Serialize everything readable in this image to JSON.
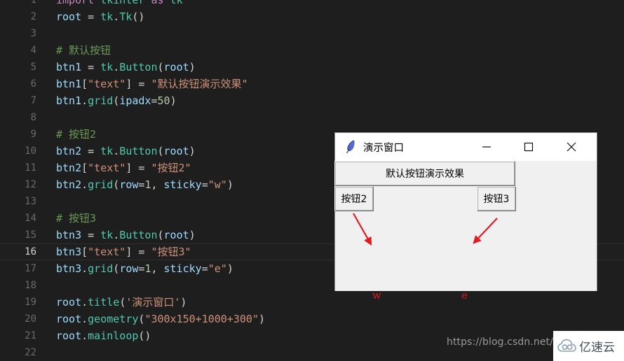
{
  "editor": {
    "theme": {
      "background": "#1e1e1e",
      "current_line_background": "#1f1f20",
      "line_number_color": "#6a6a6a",
      "keyword_color": "#c586c0",
      "string_color": "#ce9178",
      "comment_color": "#6a9955",
      "identifier_color": "#9cdcfe",
      "function_color": "#4ec9b0",
      "number_color": "#b5cea8"
    },
    "current_line": 16,
    "lines": [
      {
        "num": "1",
        "tokens": [
          {
            "t": "kw",
            "s": "import"
          },
          {
            "t": "plain",
            "s": " "
          },
          {
            "t": "mod",
            "s": "tkinter"
          },
          {
            "t": "plain",
            "s": " "
          },
          {
            "t": "kw",
            "s": "as"
          },
          {
            "t": "plain",
            "s": " "
          },
          {
            "t": "mod",
            "s": "tk"
          }
        ]
      },
      {
        "num": "2",
        "tokens": [
          {
            "t": "id",
            "s": "root"
          },
          {
            "t": "plain",
            "s": " "
          },
          {
            "t": "op",
            "s": "="
          },
          {
            "t": "plain",
            "s": " "
          },
          {
            "t": "mod",
            "s": "tk"
          },
          {
            "t": "punc",
            "s": "."
          },
          {
            "t": "fn",
            "s": "Tk"
          },
          {
            "t": "punc",
            "s": "()"
          }
        ]
      },
      {
        "num": "3",
        "tokens": []
      },
      {
        "num": "4",
        "tokens": [
          {
            "t": "com",
            "s": "# 默认按钮"
          }
        ]
      },
      {
        "num": "5",
        "tokens": [
          {
            "t": "id",
            "s": "btn1"
          },
          {
            "t": "plain",
            "s": " "
          },
          {
            "t": "op",
            "s": "="
          },
          {
            "t": "plain",
            "s": " "
          },
          {
            "t": "mod",
            "s": "tk"
          },
          {
            "t": "punc",
            "s": "."
          },
          {
            "t": "fn",
            "s": "Button"
          },
          {
            "t": "punc",
            "s": "("
          },
          {
            "t": "id",
            "s": "root"
          },
          {
            "t": "punc",
            "s": ")"
          }
        ]
      },
      {
        "num": "6",
        "tokens": [
          {
            "t": "id",
            "s": "btn1"
          },
          {
            "t": "punc",
            "s": "["
          },
          {
            "t": "str",
            "s": "\"text\""
          },
          {
            "t": "punc",
            "s": "]"
          },
          {
            "t": "plain",
            "s": " "
          },
          {
            "t": "op",
            "s": "="
          },
          {
            "t": "plain",
            "s": " "
          },
          {
            "t": "str",
            "s": "\"默认按钮演示效果\""
          }
        ]
      },
      {
        "num": "7",
        "tokens": [
          {
            "t": "id",
            "s": "btn1"
          },
          {
            "t": "punc",
            "s": "."
          },
          {
            "t": "fn",
            "s": "grid"
          },
          {
            "t": "punc",
            "s": "("
          },
          {
            "t": "id",
            "s": "ipadx"
          },
          {
            "t": "op",
            "s": "="
          },
          {
            "t": "num",
            "s": "50"
          },
          {
            "t": "punc",
            "s": ")"
          }
        ]
      },
      {
        "num": "8",
        "tokens": []
      },
      {
        "num": "9",
        "tokens": [
          {
            "t": "com",
            "s": "# 按钮2"
          }
        ]
      },
      {
        "num": "10",
        "tokens": [
          {
            "t": "id",
            "s": "btn2"
          },
          {
            "t": "plain",
            "s": " "
          },
          {
            "t": "op",
            "s": "="
          },
          {
            "t": "plain",
            "s": " "
          },
          {
            "t": "mod",
            "s": "tk"
          },
          {
            "t": "punc",
            "s": "."
          },
          {
            "t": "fn",
            "s": "Button"
          },
          {
            "t": "punc",
            "s": "("
          },
          {
            "t": "id",
            "s": "root"
          },
          {
            "t": "punc",
            "s": ")"
          }
        ]
      },
      {
        "num": "11",
        "tokens": [
          {
            "t": "id",
            "s": "btn2"
          },
          {
            "t": "punc",
            "s": "["
          },
          {
            "t": "str",
            "s": "\"text\""
          },
          {
            "t": "punc",
            "s": "]"
          },
          {
            "t": "plain",
            "s": " "
          },
          {
            "t": "op",
            "s": "="
          },
          {
            "t": "plain",
            "s": " "
          },
          {
            "t": "str",
            "s": "\"按钮2\""
          }
        ]
      },
      {
        "num": "12",
        "tokens": [
          {
            "t": "id",
            "s": "btn2"
          },
          {
            "t": "punc",
            "s": "."
          },
          {
            "t": "fn",
            "s": "grid"
          },
          {
            "t": "punc",
            "s": "("
          },
          {
            "t": "id",
            "s": "row"
          },
          {
            "t": "op",
            "s": "="
          },
          {
            "t": "num",
            "s": "1"
          },
          {
            "t": "punc",
            "s": ", "
          },
          {
            "t": "id",
            "s": "sticky"
          },
          {
            "t": "op",
            "s": "="
          },
          {
            "t": "str",
            "s": "\"w\""
          },
          {
            "t": "punc",
            "s": ")"
          }
        ]
      },
      {
        "num": "13",
        "tokens": []
      },
      {
        "num": "14",
        "tokens": [
          {
            "t": "com",
            "s": "# 按钮3"
          }
        ]
      },
      {
        "num": "15",
        "tokens": [
          {
            "t": "id",
            "s": "btn3"
          },
          {
            "t": "plain",
            "s": " "
          },
          {
            "t": "op",
            "s": "="
          },
          {
            "t": "plain",
            "s": " "
          },
          {
            "t": "mod",
            "s": "tk"
          },
          {
            "t": "punc",
            "s": "."
          },
          {
            "t": "fn",
            "s": "Button"
          },
          {
            "t": "punc",
            "s": "("
          },
          {
            "t": "id",
            "s": "root"
          },
          {
            "t": "punc",
            "s": ")"
          }
        ]
      },
      {
        "num": "16",
        "tokens": [
          {
            "t": "id",
            "s": "btn3"
          },
          {
            "t": "punc",
            "s": "["
          },
          {
            "t": "str",
            "s": "\"text\""
          },
          {
            "t": "punc",
            "s": "]"
          },
          {
            "t": "plain",
            "s": " "
          },
          {
            "t": "op",
            "s": "="
          },
          {
            "t": "plain",
            "s": " "
          },
          {
            "t": "str",
            "s": "\"按钮3\""
          }
        ]
      },
      {
        "num": "17",
        "tokens": [
          {
            "t": "id",
            "s": "btn3"
          },
          {
            "t": "punc",
            "s": "."
          },
          {
            "t": "fn",
            "s": "grid"
          },
          {
            "t": "punc",
            "s": "("
          },
          {
            "t": "id",
            "s": "row"
          },
          {
            "t": "op",
            "s": "="
          },
          {
            "t": "num",
            "s": "1"
          },
          {
            "t": "punc",
            "s": ", "
          },
          {
            "t": "id",
            "s": "sticky"
          },
          {
            "t": "op",
            "s": "="
          },
          {
            "t": "str",
            "s": "\"e\""
          },
          {
            "t": "punc",
            "s": ")"
          }
        ]
      },
      {
        "num": "18",
        "tokens": []
      },
      {
        "num": "19",
        "tokens": [
          {
            "t": "id",
            "s": "root"
          },
          {
            "t": "punc",
            "s": "."
          },
          {
            "t": "fn",
            "s": "title"
          },
          {
            "t": "punc",
            "s": "("
          },
          {
            "t": "str",
            "s": "'演示窗口'"
          },
          {
            "t": "punc",
            "s": ")"
          }
        ]
      },
      {
        "num": "20",
        "tokens": [
          {
            "t": "id",
            "s": "root"
          },
          {
            "t": "punc",
            "s": "."
          },
          {
            "t": "fn",
            "s": "geometry"
          },
          {
            "t": "punc",
            "s": "("
          },
          {
            "t": "str",
            "s": "\"300x150+1000+300\""
          },
          {
            "t": "punc",
            "s": ")"
          }
        ]
      },
      {
        "num": "21",
        "tokens": [
          {
            "t": "id",
            "s": "root"
          },
          {
            "t": "punc",
            "s": "."
          },
          {
            "t": "fn",
            "s": "mainloop"
          },
          {
            "t": "punc",
            "s": "()"
          }
        ]
      },
      {
        "num": "22",
        "tokens": []
      }
    ]
  },
  "tk_window": {
    "title": "演示窗口",
    "icon": "tkinter-feather-icon",
    "controls": {
      "minimize": "minimize-icon",
      "maximize": "maximize-icon",
      "close": "close-icon"
    },
    "buttons": [
      {
        "id": "btn1",
        "label": "默认按钮演示效果"
      },
      {
        "id": "btn2",
        "label": "按钮2"
      },
      {
        "id": "btn3",
        "label": "按钮3"
      }
    ],
    "annotations": [
      {
        "label": "w",
        "color": "#e01b24"
      },
      {
        "label": "e",
        "color": "#e01b24"
      }
    ]
  },
  "watermark": {
    "url": "https://blog.csdn.net/q",
    "logo_text": "亿速云",
    "logo_mark": "cloud-icon"
  }
}
